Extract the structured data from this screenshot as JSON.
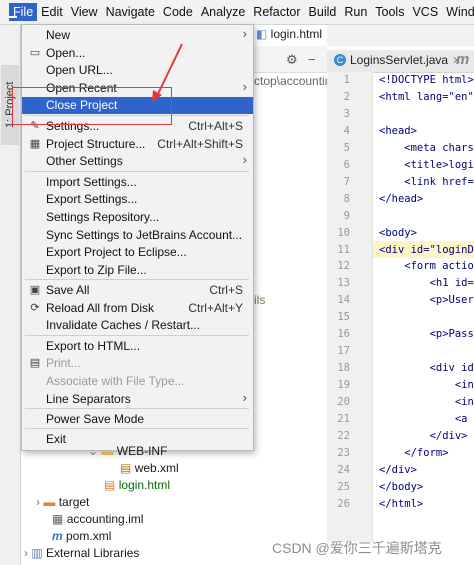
{
  "menubar": {
    "items": [
      "File",
      "Edit",
      "View",
      "Navigate",
      "Code",
      "Analyze",
      "Refactor",
      "Build",
      "Run",
      "Tools",
      "VCS",
      "Windo"
    ]
  },
  "editor": {
    "top_tab": "login.html",
    "active_tab": "LoginsServlet.java",
    "line_numbers": [
      "1",
      "2",
      "3",
      "4",
      "5",
      "6",
      "7",
      "8",
      "9",
      "10",
      "11",
      "12",
      "13",
      "14",
      "15",
      "16",
      "17",
      "18",
      "19",
      "20",
      "21",
      "22",
      "23",
      "24",
      "25",
      "26"
    ],
    "code_lines": [
      "<!DOCTYPE html>",
      "<html lang=\"en\">",
      "",
      "<head>",
      "    <meta charse",
      "    <title>login",
      "    <link href=\"",
      "</head>",
      "",
      "<body>",
      "<div id=\"loginDi",
      "    <form action",
      "        <h1 id=\"",
      "        <p>Usern",
      "",
      "        <p>Passw",
      "",
      "        <div id=",
      "            <inpu",
      "            <inpu",
      "            <a h",
      "        </div>",
      "    </form>",
      "</div>",
      "</body>",
      "</html>"
    ]
  },
  "project": {
    "side_tab": "1: Project",
    "path_fragment": "ctop\\accountin",
    "ils_fragment": "ils",
    "tree": {
      "web_inf": "WEB-INF",
      "web_xml": "web.xml",
      "login_html": "login.html",
      "target": "target",
      "accounting_iml": "accounting.iml",
      "pom_xml": "pom.xml",
      "external_libraries": "External Libraries"
    }
  },
  "file_menu": {
    "items": [
      {
        "label": "New",
        "submenu": true
      },
      {
        "label": "Open...",
        "icon": "folder-icon"
      },
      {
        "label": "Open URL..."
      },
      {
        "label": "Open Recent",
        "submenu": true
      },
      {
        "label": "Close Project",
        "selected": true
      },
      {
        "label": "Settings...",
        "shortcut": "Ctrl+Alt+S",
        "icon": "wrench-icon"
      },
      {
        "label": "Project Structure...",
        "shortcut": "Ctrl+Alt+Shift+S",
        "icon": "project-structure-icon"
      },
      {
        "label": "Other Settings",
        "submenu": true
      },
      {
        "label": "Import Settings..."
      },
      {
        "label": "Export Settings..."
      },
      {
        "label": "Settings Repository..."
      },
      {
        "label": "Sync Settings to JetBrains Account..."
      },
      {
        "label": "Export Project to Eclipse..."
      },
      {
        "label": "Export to Zip File..."
      },
      {
        "label": "Save All",
        "shortcut": "Ctrl+S",
        "icon": "save-icon"
      },
      {
        "label": "Reload All from Disk",
        "shortcut": "Ctrl+Alt+Y",
        "icon": "reload-icon"
      },
      {
        "label": "Invalidate Caches / Restart..."
      },
      {
        "label": "Export to HTML..."
      },
      {
        "label": "Print...",
        "disabled": true,
        "icon": "print-icon"
      },
      {
        "label": "Associate with File Type...",
        "disabled": true
      },
      {
        "label": "Line Separators",
        "submenu": true
      },
      {
        "label": "Power Save Mode"
      },
      {
        "label": "Exit"
      }
    ]
  },
  "watermark": "CSDN @爱你三千遍斯塔克"
}
